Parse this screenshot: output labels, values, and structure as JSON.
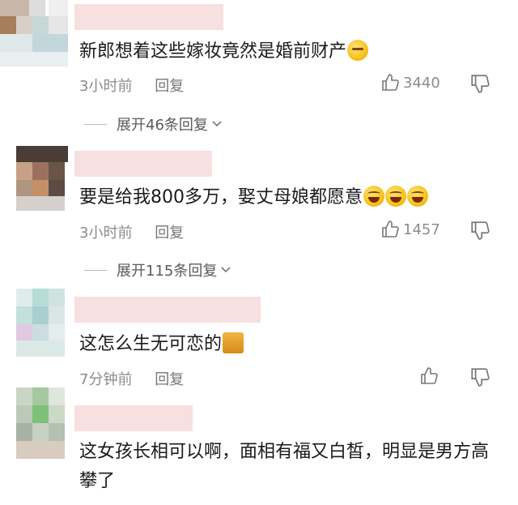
{
  "comments": [
    {
      "text": "新郎想着这些嫁妆竟然是婚前财产",
      "emoji": "thinking-face-icon",
      "time": "3小时前",
      "reply_label": "回复",
      "likes": "3440",
      "expand": "展开46条回复"
    },
    {
      "text": "要是给我800多万，娶丈母娘都愿意",
      "emoji": "laughing-tears-icon",
      "time": "3小时前",
      "reply_label": "回复",
      "likes": "1457",
      "expand": "展开115条回复"
    },
    {
      "text": "这怎么生无可恋的",
      "emoji": "cat-face-icon",
      "time": "7分钟前",
      "reply_label": "回复",
      "likes": "",
      "expand": ""
    },
    {
      "text": "这女孩长相可以啊，面相有福又白皙，明显是男方高攀了",
      "emoji": "",
      "time": "",
      "reply_label": "",
      "likes": "",
      "expand": ""
    }
  ],
  "colors": {
    "text": "#1a1a1a",
    "meta": "#8c8c8c",
    "name_blur": "#f8dfe0"
  }
}
